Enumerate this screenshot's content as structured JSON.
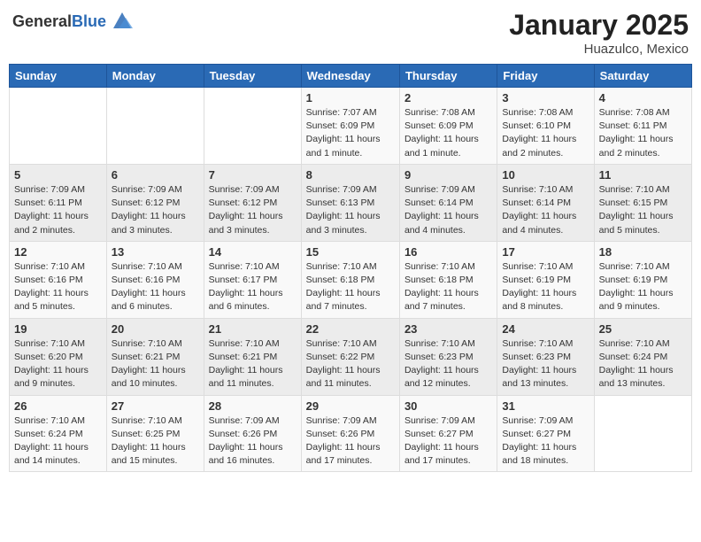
{
  "header": {
    "logo_general": "General",
    "logo_blue": "Blue",
    "month": "January 2025",
    "location": "Huazulco, Mexico"
  },
  "weekdays": [
    "Sunday",
    "Monday",
    "Tuesday",
    "Wednesday",
    "Thursday",
    "Friday",
    "Saturday"
  ],
  "weeks": [
    [
      {
        "day": "",
        "info": ""
      },
      {
        "day": "",
        "info": ""
      },
      {
        "day": "",
        "info": ""
      },
      {
        "day": "1",
        "info": "Sunrise: 7:07 AM\nSunset: 6:09 PM\nDaylight: 11 hours and 1 minute."
      },
      {
        "day": "2",
        "info": "Sunrise: 7:08 AM\nSunset: 6:09 PM\nDaylight: 11 hours and 1 minute."
      },
      {
        "day": "3",
        "info": "Sunrise: 7:08 AM\nSunset: 6:10 PM\nDaylight: 11 hours and 2 minutes."
      },
      {
        "day": "4",
        "info": "Sunrise: 7:08 AM\nSunset: 6:11 PM\nDaylight: 11 hours and 2 minutes."
      }
    ],
    [
      {
        "day": "5",
        "info": "Sunrise: 7:09 AM\nSunset: 6:11 PM\nDaylight: 11 hours and 2 minutes."
      },
      {
        "day": "6",
        "info": "Sunrise: 7:09 AM\nSunset: 6:12 PM\nDaylight: 11 hours and 3 minutes."
      },
      {
        "day": "7",
        "info": "Sunrise: 7:09 AM\nSunset: 6:12 PM\nDaylight: 11 hours and 3 minutes."
      },
      {
        "day": "8",
        "info": "Sunrise: 7:09 AM\nSunset: 6:13 PM\nDaylight: 11 hours and 3 minutes."
      },
      {
        "day": "9",
        "info": "Sunrise: 7:09 AM\nSunset: 6:14 PM\nDaylight: 11 hours and 4 minutes."
      },
      {
        "day": "10",
        "info": "Sunrise: 7:10 AM\nSunset: 6:14 PM\nDaylight: 11 hours and 4 minutes."
      },
      {
        "day": "11",
        "info": "Sunrise: 7:10 AM\nSunset: 6:15 PM\nDaylight: 11 hours and 5 minutes."
      }
    ],
    [
      {
        "day": "12",
        "info": "Sunrise: 7:10 AM\nSunset: 6:16 PM\nDaylight: 11 hours and 5 minutes."
      },
      {
        "day": "13",
        "info": "Sunrise: 7:10 AM\nSunset: 6:16 PM\nDaylight: 11 hours and 6 minutes."
      },
      {
        "day": "14",
        "info": "Sunrise: 7:10 AM\nSunset: 6:17 PM\nDaylight: 11 hours and 6 minutes."
      },
      {
        "day": "15",
        "info": "Sunrise: 7:10 AM\nSunset: 6:18 PM\nDaylight: 11 hours and 7 minutes."
      },
      {
        "day": "16",
        "info": "Sunrise: 7:10 AM\nSunset: 6:18 PM\nDaylight: 11 hours and 7 minutes."
      },
      {
        "day": "17",
        "info": "Sunrise: 7:10 AM\nSunset: 6:19 PM\nDaylight: 11 hours and 8 minutes."
      },
      {
        "day": "18",
        "info": "Sunrise: 7:10 AM\nSunset: 6:19 PM\nDaylight: 11 hours and 9 minutes."
      }
    ],
    [
      {
        "day": "19",
        "info": "Sunrise: 7:10 AM\nSunset: 6:20 PM\nDaylight: 11 hours and 9 minutes."
      },
      {
        "day": "20",
        "info": "Sunrise: 7:10 AM\nSunset: 6:21 PM\nDaylight: 11 hours and 10 minutes."
      },
      {
        "day": "21",
        "info": "Sunrise: 7:10 AM\nSunset: 6:21 PM\nDaylight: 11 hours and 11 minutes."
      },
      {
        "day": "22",
        "info": "Sunrise: 7:10 AM\nSunset: 6:22 PM\nDaylight: 11 hours and 11 minutes."
      },
      {
        "day": "23",
        "info": "Sunrise: 7:10 AM\nSunset: 6:23 PM\nDaylight: 11 hours and 12 minutes."
      },
      {
        "day": "24",
        "info": "Sunrise: 7:10 AM\nSunset: 6:23 PM\nDaylight: 11 hours and 13 minutes."
      },
      {
        "day": "25",
        "info": "Sunrise: 7:10 AM\nSunset: 6:24 PM\nDaylight: 11 hours and 13 minutes."
      }
    ],
    [
      {
        "day": "26",
        "info": "Sunrise: 7:10 AM\nSunset: 6:24 PM\nDaylight: 11 hours and 14 minutes."
      },
      {
        "day": "27",
        "info": "Sunrise: 7:10 AM\nSunset: 6:25 PM\nDaylight: 11 hours and 15 minutes."
      },
      {
        "day": "28",
        "info": "Sunrise: 7:09 AM\nSunset: 6:26 PM\nDaylight: 11 hours and 16 minutes."
      },
      {
        "day": "29",
        "info": "Sunrise: 7:09 AM\nSunset: 6:26 PM\nDaylight: 11 hours and 17 minutes."
      },
      {
        "day": "30",
        "info": "Sunrise: 7:09 AM\nSunset: 6:27 PM\nDaylight: 11 hours and 17 minutes."
      },
      {
        "day": "31",
        "info": "Sunrise: 7:09 AM\nSunset: 6:27 PM\nDaylight: 11 hours and 18 minutes."
      },
      {
        "day": "",
        "info": ""
      }
    ]
  ]
}
